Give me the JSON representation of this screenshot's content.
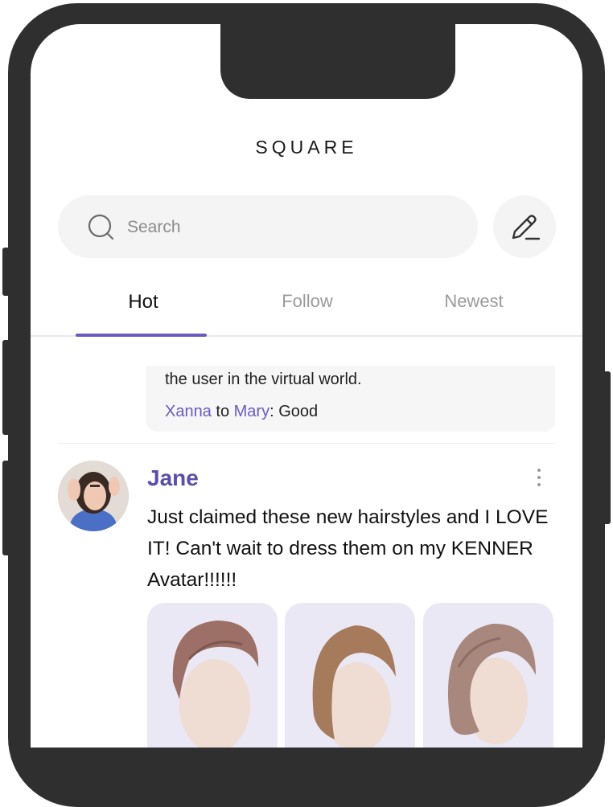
{
  "header": {
    "title": "SQUARE"
  },
  "search": {
    "placeholder": "Search"
  },
  "tabs": [
    {
      "label": "Hot",
      "active": true
    },
    {
      "label": "Follow",
      "active": false
    },
    {
      "label": "Newest",
      "active": false
    }
  ],
  "previous_post": {
    "text_tail": "the user in the virtual world.",
    "comment": {
      "from": "Xanna",
      "connector": " to ",
      "to": "Mary",
      "text": ": Good"
    }
  },
  "post": {
    "author": "Jane",
    "text": "Just claimed these new hairstyles and I LOVE IT! Can't wait to dress them on my KENNER Avatar!!!!!!",
    "images": [
      "hairstyle-1",
      "hairstyle-2",
      "hairstyle-3"
    ]
  },
  "colors": {
    "accent": "#6a5bc3",
    "author": "#5a4ea8",
    "frame": "#2f2f2f",
    "thumb_bg": "#ebe8f5"
  }
}
